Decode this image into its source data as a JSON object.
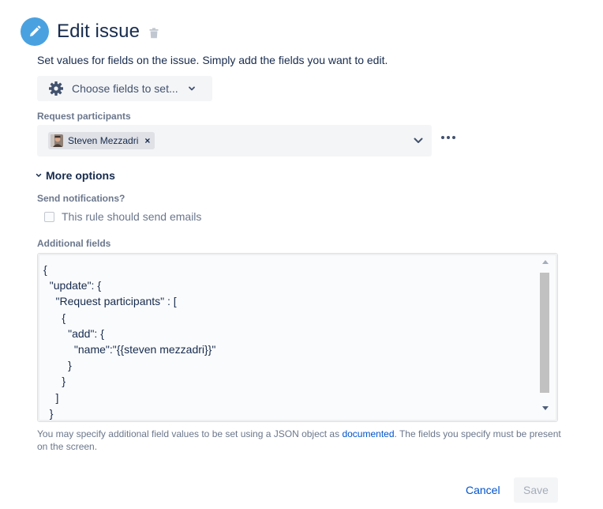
{
  "header": {
    "title": "Edit issue",
    "icon": "pencil-icon",
    "delete_icon": "trash-icon",
    "accent_color": "#4aa1e0"
  },
  "intro_text": "Set values for fields on the issue. Simply add the fields you want to edit.",
  "choose_fields": {
    "label": "Choose fields to set...",
    "icon": "gear-icon"
  },
  "request_participants": {
    "label": "Request participants",
    "selected": [
      {
        "name": "Steven Mezzadri",
        "remove_label": "×"
      }
    ]
  },
  "more_options": {
    "label": "More options",
    "expanded": true
  },
  "send_notifications": {
    "label": "Send notifications?",
    "checkbox_label": "This rule should send emails",
    "checked": false
  },
  "additional_fields": {
    "label": "Additional fields",
    "value": "{\n  \"update\": {\n    \"Request participants\" : [\n      {\n        \"add\": {\n          \"name\":\"{{steven mezzadri}}\"\n        }\n      }\n    ]\n  }",
    "help_prefix": "You may specify additional field values to be set using a JSON object as ",
    "help_link": "documented",
    "help_suffix": ". The fields you specify must be present on the screen."
  },
  "footer": {
    "cancel_label": "Cancel",
    "save_label": "Save"
  }
}
